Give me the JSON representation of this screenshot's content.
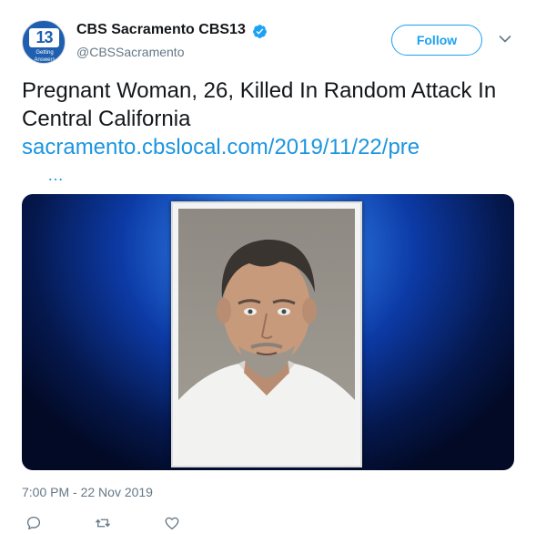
{
  "account": {
    "display_name": "CBS Sacramento CBS13",
    "handle": "@CBSSacramento",
    "avatar": {
      "logo_text": "13",
      "tagline": "Getting Answers"
    },
    "verified_icon": "verified-badge-icon"
  },
  "header": {
    "follow_label": "Follow",
    "menu_icon": "chevron-down-icon"
  },
  "tweet": {
    "text": "Pregnant Woman, 26, Killed In Random Attack In Central California",
    "link": "sacramento.cbslocal.com/2019/11/22/pre",
    "ellipsis": "…",
    "timestamp": "7:00 PM - 22 Nov 2019"
  },
  "actions": {
    "reply_icon": "reply-icon",
    "retweet_icon": "retweet-icon",
    "like_icon": "heart-icon"
  },
  "colors": {
    "link": "#1b95e0",
    "follow": "#1da1f2",
    "secondary_text": "#657786"
  }
}
